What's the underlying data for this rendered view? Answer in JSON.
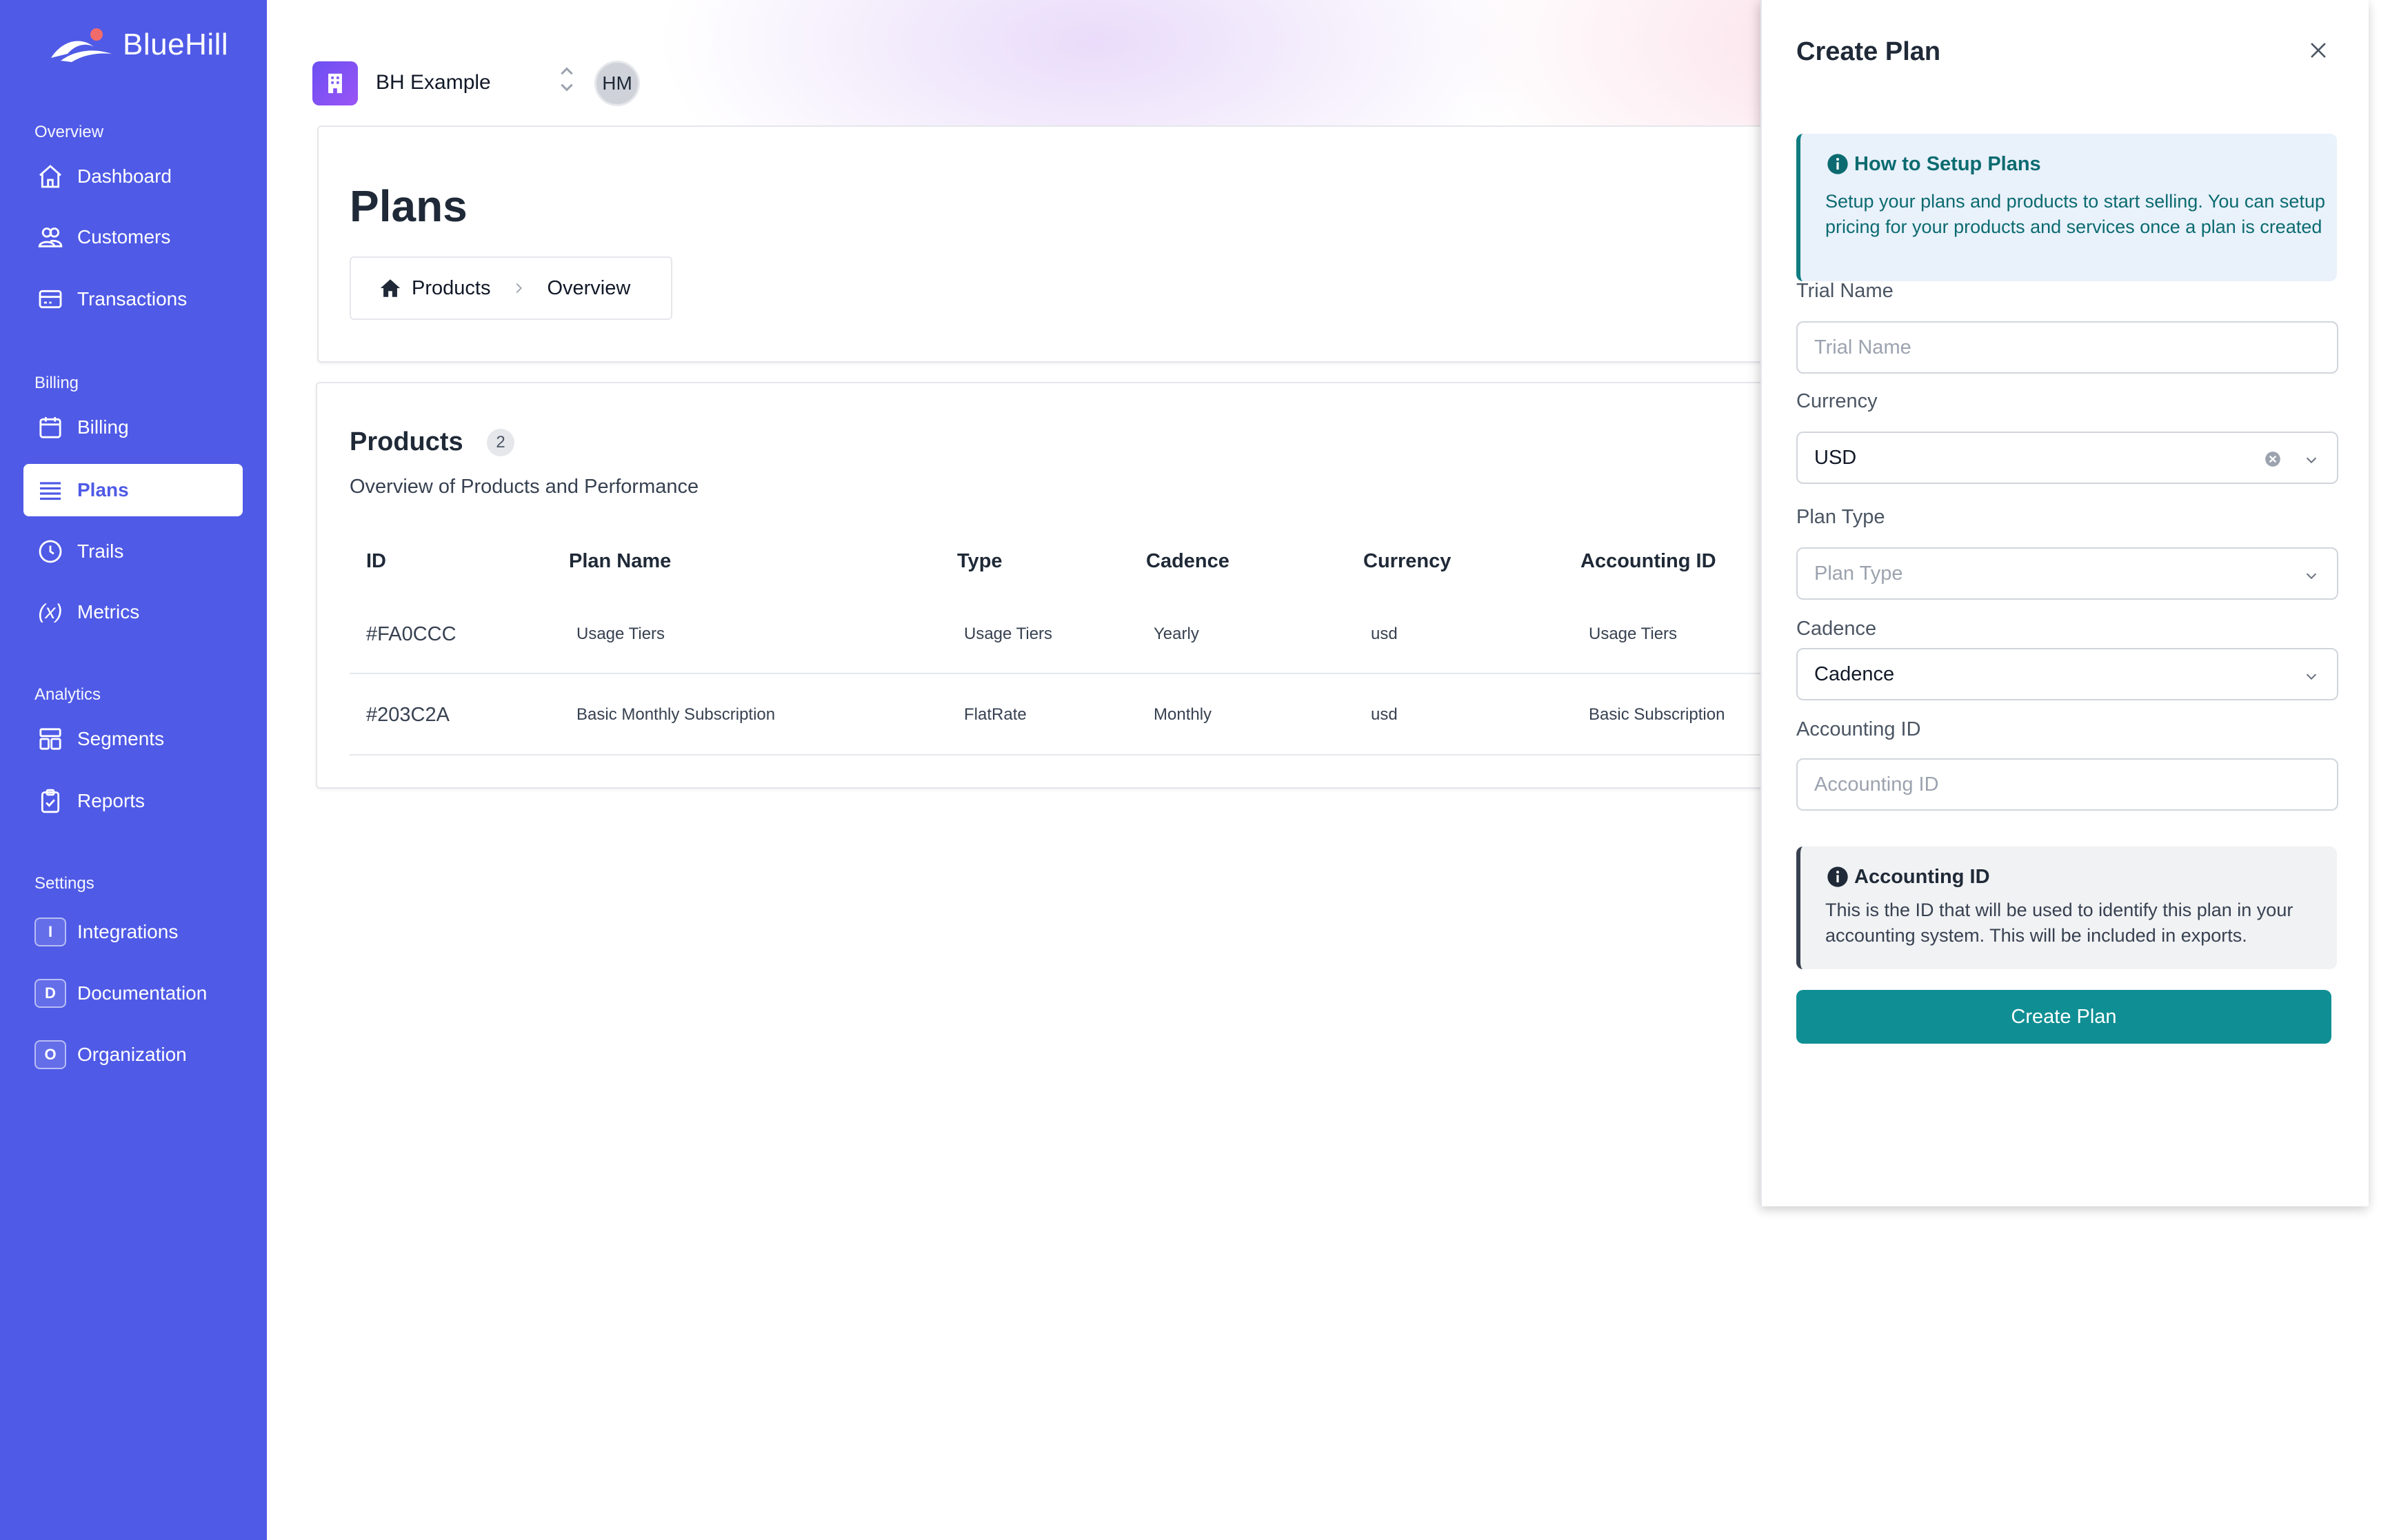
{
  "app": {
    "name": "BlueHill"
  },
  "sidebar": {
    "sections": [
      {
        "label": "Overview"
      },
      {
        "label": "Billing"
      },
      {
        "label": "Analytics"
      },
      {
        "label": "Settings"
      }
    ],
    "items": [
      {
        "label": "Dashboard",
        "icon": "home-icon"
      },
      {
        "label": "Customers",
        "icon": "users-icon"
      },
      {
        "label": "Transactions",
        "icon": "card-icon"
      },
      {
        "label": "Billing",
        "icon": "calendar-icon"
      },
      {
        "label": "Plans",
        "icon": "list-icon",
        "active": true
      },
      {
        "label": "Trails",
        "icon": "clock-icon"
      },
      {
        "label": "Metrics",
        "icon": "variable-icon",
        "glyph": "(x)"
      },
      {
        "label": "Segments",
        "icon": "segments-icon"
      },
      {
        "label": "Reports",
        "icon": "clipboard-icon"
      },
      {
        "label": "Integrations",
        "letter": "I"
      },
      {
        "label": "Documentation",
        "letter": "D"
      },
      {
        "label": "Organization",
        "letter": "O"
      }
    ]
  },
  "topbar": {
    "org_name": "BH Example",
    "avatar_initials": "HM"
  },
  "page": {
    "title": "Plans",
    "breadcrumb": [
      "Products",
      "Overview"
    ]
  },
  "products": {
    "title": "Products",
    "count": "2",
    "subtitle": "Overview of Products and Performance",
    "columns": [
      "ID",
      "Plan Name",
      "Type",
      "Cadence",
      "Currency",
      "Accounting ID"
    ],
    "rows": [
      {
        "id": "#FA0CCC",
        "plan_name": "Usage Tiers",
        "type": "Usage Tiers",
        "cadence": "Yearly",
        "currency": "usd",
        "accounting_id": "Usage Tiers"
      },
      {
        "id": "#203C2A",
        "plan_name": "Basic Monthly Subscription",
        "type": "FlatRate",
        "cadence": "Monthly",
        "currency": "usd",
        "accounting_id": "Basic Subscription"
      }
    ]
  },
  "drawer": {
    "title": "Create Plan",
    "info": {
      "title": "How to Setup Plans",
      "body": "Setup your plans and products to start selling. You can setup pricing for your products and services once a plan is created"
    },
    "fields": {
      "trial_name": {
        "label": "Trial Name",
        "placeholder": "Trial Name"
      },
      "currency": {
        "label": "Currency",
        "value": "USD"
      },
      "plan_type": {
        "label": "Plan Type",
        "placeholder": "Plan Type"
      },
      "cadence": {
        "label": "Cadence",
        "value": "Cadence"
      },
      "accounting_id": {
        "label": "Accounting ID",
        "placeholder": "Accounting ID"
      }
    },
    "note": {
      "title": "Accounting ID",
      "body": "This is the ID that will be used to identify this plan in your accounting system. This will be included in exports."
    },
    "submit_label": "Create Plan"
  },
  "colors": {
    "sidebar": "#4f5ae6",
    "accent": "#0f8f94",
    "info_text": "#0b6b70"
  }
}
